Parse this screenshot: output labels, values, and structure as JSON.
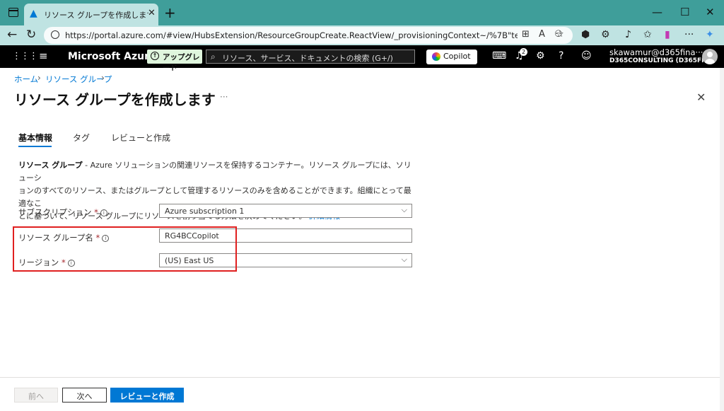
{
  "browser": {
    "tab_title": "リソース グループを作成します - Micros",
    "url": "https://portal.azure.com/#view/HubsExtension/ResourceGroupCreate.ReactView/_provisioningContext~/%7B\"telemetryId\"...",
    "new_tab": "+",
    "tab_close": "✕"
  },
  "azure": {
    "brand": "Microsoft Azure",
    "upgrade_label": "アップグレード",
    "search_placeholder": "リソース、サービス、ドキュメントの検索 (G+/)",
    "copilot_label": "Copilot",
    "notifications_count": "2",
    "account_name": "skawamur@d365fina···",
    "tenant_name": "D365CONSULTING (D365FI···"
  },
  "breadcrumb": {
    "home": "ホーム",
    "resource_groups": "リソース グループ"
  },
  "page": {
    "title": "リソース グループを作成します",
    "more": "···"
  },
  "tabs": [
    "基本情報",
    "タグ",
    "レビューと作成"
  ],
  "description": {
    "term": "リソース グループ",
    "text_line1": " - Azure ソリューションの関連リソースを保持するコンテナー。リソース グループには、ソリューシ",
    "text_line2": "ョンのすべてのリソース、またはグループとして管理するリソースのみを含めることができます。組織にとって最適なこ",
    "text_line3": "とに基づいて、リソース グループにリソースを割り当てる方法を決めてください。",
    "link": "詳細情報"
  },
  "form": {
    "subscription_label": "サブスクリプション",
    "subscription_value": "Azure subscription 1",
    "rg_name_label": "リソース グループ名",
    "rg_name_value": "RG4BCCopilot",
    "region_label": "リージョン",
    "region_value": "(US) East US",
    "required_mark": "*"
  },
  "footer": {
    "prev": "前へ",
    "next": "次へ",
    "review": "レビューと作成"
  }
}
